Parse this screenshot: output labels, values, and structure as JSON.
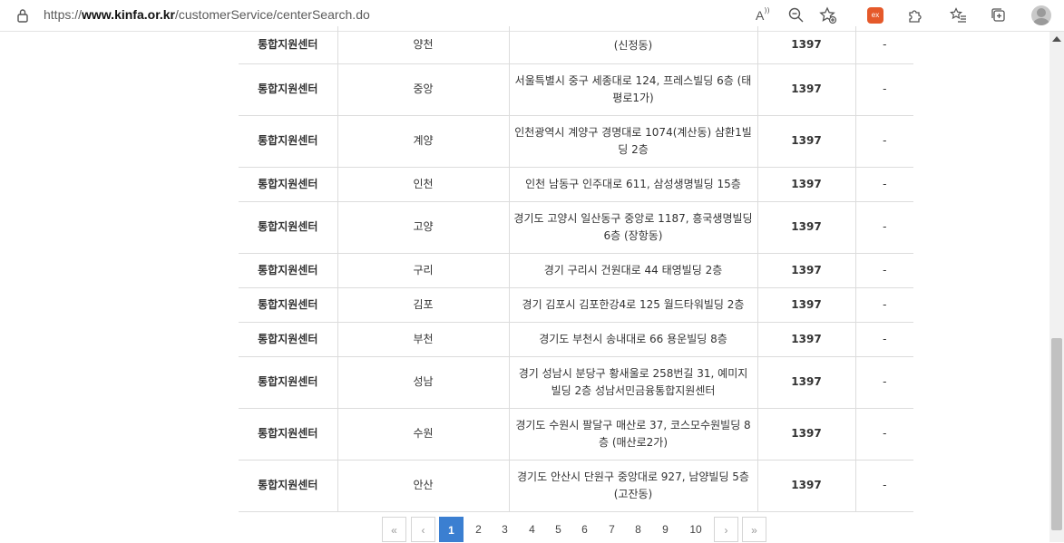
{
  "browser": {
    "url_prefix": "https://",
    "url_domain": "www.kinfa.or.kr",
    "url_path": "/customerService/centerSearch.do",
    "read_aloud_label": "A",
    "ext_label": "ex"
  },
  "table": {
    "rows": [
      {
        "type": "통합지원센터",
        "region": "양천",
        "address": "(신정동)",
        "tel": "1397",
        "note": "-"
      },
      {
        "type": "통합지원센터",
        "region": "중앙",
        "address": "서울특별시 중구 세종대로 124, 프레스빌딩 6층 (태평로1가)",
        "tel": "1397",
        "note": "-"
      },
      {
        "type": "통합지원센터",
        "region": "계양",
        "address": "인천광역시 계양구 경명대로 1074(계산동) 삼환1빌딩 2층",
        "tel": "1397",
        "note": "-"
      },
      {
        "type": "통합지원센터",
        "region": "인천",
        "address": "인천 남동구 인주대로 611, 삼성생명빌딩 15층",
        "tel": "1397",
        "note": "-"
      },
      {
        "type": "통합지원센터",
        "region": "고양",
        "address": "경기도 고양시 일산동구 중앙로 1187, 흥국생명빌딩 6층 (장항동)",
        "tel": "1397",
        "note": "-"
      },
      {
        "type": "통합지원센터",
        "region": "구리",
        "address": "경기 구리시 건원대로 44 태영빌딩 2층",
        "tel": "1397",
        "note": "-"
      },
      {
        "type": "통합지원센터",
        "region": "김포",
        "address": "경기 김포시 김포한강4로 125 월드타워빌딩 2층",
        "tel": "1397",
        "note": "-"
      },
      {
        "type": "통합지원센터",
        "region": "부천",
        "address": "경기도 부천시 송내대로 66 용운빌딩 8층",
        "tel": "1397",
        "note": "-"
      },
      {
        "type": "통합지원센터",
        "region": "성남",
        "address": "경기 성남시 분당구 황새울로 258번길 31, 예미지 빌딩 2층 성남서민금융통합지원센터",
        "tel": "1397",
        "note": "-"
      },
      {
        "type": "통합지원센터",
        "region": "수원",
        "address": "경기도 수원시 팔달구 매산로 37, 코스모수원빌딩 8층 (매산로2가)",
        "tel": "1397",
        "note": "-"
      },
      {
        "type": "통합지원센터",
        "region": "안산",
        "address": "경기도 안산시 단원구 중앙대로 927, 남양빌딩 5층 (고잔동)",
        "tel": "1397",
        "note": "-"
      }
    ]
  },
  "pagination": {
    "first": "«",
    "prev": "‹",
    "pages": [
      "1",
      "2",
      "3",
      "4",
      "5",
      "6",
      "7",
      "8",
      "9",
      "10"
    ],
    "current": "1",
    "next": "›",
    "last": "»"
  },
  "colors": {
    "accent": "#3b7fd1",
    "border": "#dcdcdc"
  }
}
